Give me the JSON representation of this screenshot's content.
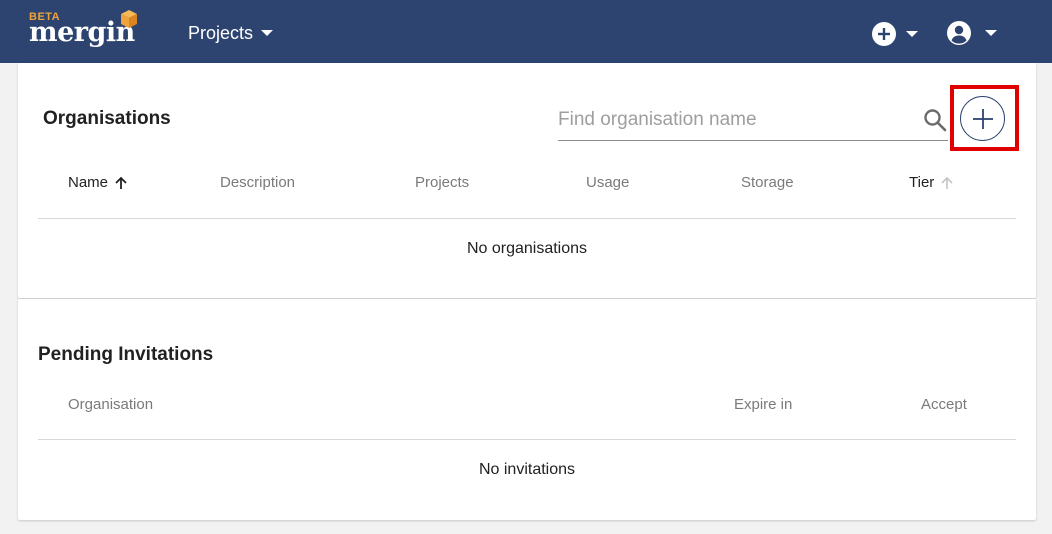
{
  "header": {
    "logo_beta": "BETA",
    "logo_text": "mergin",
    "projects_label": "Projects",
    "colors": {
      "bar": "#2d4470",
      "accent": "#f0a23b"
    },
    "icons": [
      "plus-circle-icon",
      "chevron-down-icon",
      "account-circle-icon"
    ]
  },
  "organisations": {
    "title": "Organisations",
    "search_placeholder": "Find organisation name",
    "columns": {
      "name": "Name",
      "description": "Description",
      "projects": "Projects",
      "usage": "Usage",
      "storage": "Storage",
      "tier": "Tier"
    },
    "empty": "No organisations",
    "highlight_color": "#e00000"
  },
  "invitations": {
    "title": "Pending Invitations",
    "columns": {
      "organisation": "Organisation",
      "expire": "Expire in",
      "accept": "Accept"
    },
    "empty": "No invitations"
  }
}
